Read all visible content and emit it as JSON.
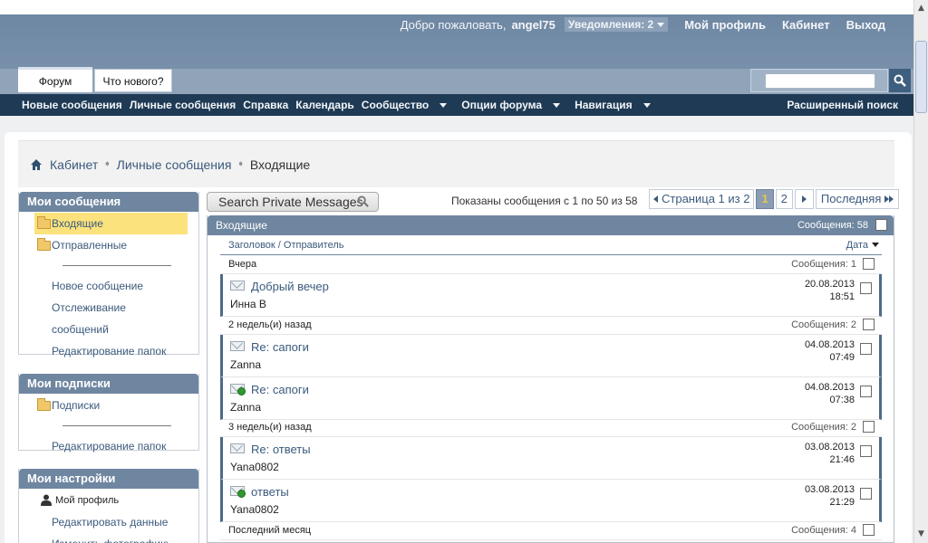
{
  "header": {
    "welcome": "Добро пожаловать,",
    "username": "angel75",
    "notifications": "Уведомления: 2",
    "profile": "Мой профиль",
    "cabinet": "Кабинет",
    "logout": "Выход"
  },
  "tabs": [
    {
      "label": "Форум",
      "active": true
    },
    {
      "label": "Что нового?",
      "active": false
    }
  ],
  "nav": {
    "items": [
      "Новые сообщения",
      "Личные сообщения",
      "Справка",
      "Календарь",
      "Сообщество",
      "Опции форума",
      "Навигация"
    ],
    "advanced_search": "Расширенный поиск"
  },
  "breadcrumb": {
    "items": [
      "Кабинет",
      "Личные сообщения"
    ],
    "current": "Входящие"
  },
  "sidebar": {
    "my_messages": {
      "title": "Мои сообщения",
      "folders": [
        "Входящие",
        "Отправленные"
      ],
      "links": [
        "Новое сообщение",
        "Отслеживание",
        "сообщений",
        "Редактирование папок"
      ]
    },
    "my_subscriptions": {
      "title": "Мои подписки",
      "folders": [
        "Подписки"
      ],
      "links": [
        "Редактирование папок"
      ]
    },
    "my_settings": {
      "title": "Мои настройки",
      "profile": "Мой профиль",
      "links": [
        "Редактировать данные",
        "Изменить фотографию"
      ]
    }
  },
  "toolbar": {
    "search_pm": "Search Private Messages",
    "shown": "Показаны сообщения с 1 по 50 из 58"
  },
  "pager": {
    "page_label": "Страница 1 из 2",
    "pages": [
      "1",
      "2"
    ],
    "current": "1",
    "last": "Последняя"
  },
  "panel": {
    "title": "Входящие",
    "count": "Сообщения:  58",
    "col_subject": "Заголовок / Отправитель",
    "col_date": "Дата"
  },
  "groups": [
    {
      "label": "Вчера",
      "count": "Сообщения: 1"
    },
    {
      "label": "2 недель(и) назад",
      "count": "Сообщения: 2"
    },
    {
      "label": "3 недель(и) назад",
      "count": "Сообщения: 2"
    },
    {
      "label": "Последний месяц",
      "count": "Сообщения: 4"
    }
  ],
  "messages": [
    {
      "title": "Добрый вечер",
      "sender": "Инна В",
      "date": "20.08.2013",
      "time": "18:51",
      "replied": false
    },
    {
      "title": "Re: сапоги",
      "sender": "Zanna",
      "date": "04.08.2013",
      "time": "07:49",
      "replied": false
    },
    {
      "title": "Re: сапоги",
      "sender": "Zanna",
      "date": "04.08.2013",
      "time": "07:38",
      "replied": true
    },
    {
      "title": "Re: ответы",
      "sender": "Yana0802",
      "date": "03.08.2013",
      "time": "21:46",
      "replied": false
    },
    {
      "title": "ответы",
      "sender": "Yana0802",
      "date": "03.08.2013",
      "time": "21:29",
      "replied": true
    }
  ],
  "colors": {
    "header_bg": "#7890ab",
    "navbar_bg": "#1f3a55",
    "block_head": "#6f86a0",
    "link": "#3b5a7d",
    "selected_folder": "#fbe27d"
  }
}
